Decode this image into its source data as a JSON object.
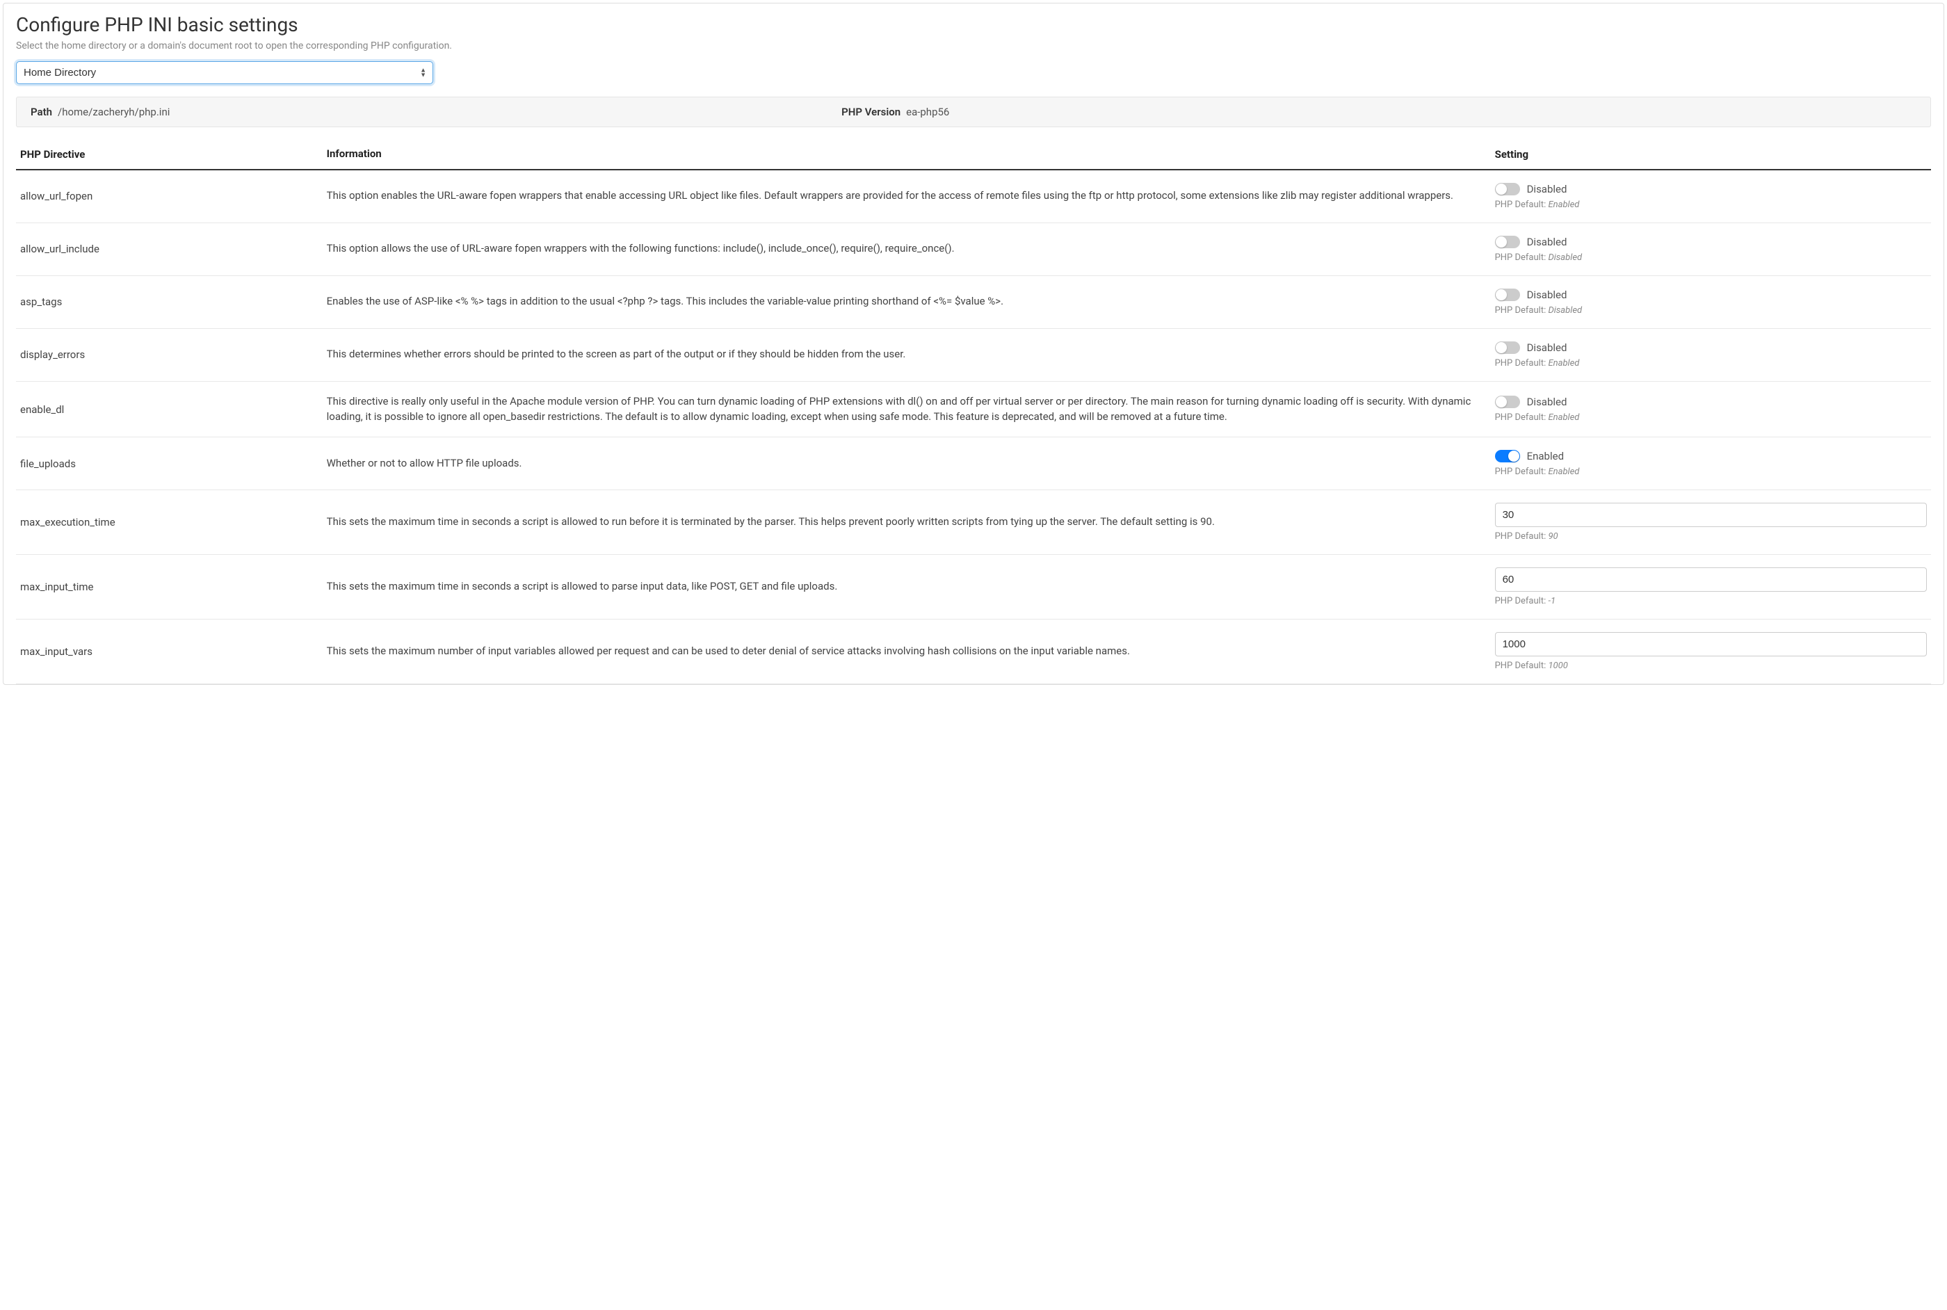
{
  "header": {
    "title": "Configure PHP INI basic settings",
    "subtitle": "Select the home directory or a domain's document root to open the corresponding PHP configuration."
  },
  "selector": {
    "selected": "Home Directory"
  },
  "infoBar": {
    "pathLabel": "Path",
    "pathValue": "/home/zacheryh/php.ini",
    "versionLabel": "PHP Version",
    "versionValue": "ea-php56"
  },
  "columns": {
    "directive": "PHP Directive",
    "info": "Information",
    "setting": "Setting"
  },
  "labels": {
    "enabled": "Enabled",
    "disabled": "Disabled",
    "phpDefault": "PHP Default:"
  },
  "directives": [
    {
      "name": "allow_url_fopen",
      "info": "This option enables the URL-aware fopen wrappers that enable accessing URL object like files. Default wrappers are provided for the access of remote files using the ftp or http protocol, some extensions like zlib may register additional wrappers.",
      "type": "toggle",
      "enabled": false,
      "default": "Enabled"
    },
    {
      "name": "allow_url_include",
      "info": "This option allows the use of URL-aware fopen wrappers with the following functions: include(), include_once(), require(), require_once().",
      "type": "toggle",
      "enabled": false,
      "default": "Disabled"
    },
    {
      "name": "asp_tags",
      "info": "Enables the use of ASP-like <% %> tags in addition to the usual <?php ?> tags. This includes the variable-value printing shorthand of <%= $value %>.",
      "type": "toggle",
      "enabled": false,
      "default": "Disabled"
    },
    {
      "name": "display_errors",
      "info": "This determines whether errors should be printed to the screen as part of the output or if they should be hidden from the user.",
      "type": "toggle",
      "enabled": false,
      "default": "Enabled"
    },
    {
      "name": "enable_dl",
      "info": "This directive is really only useful in the Apache module version of PHP. You can turn dynamic loading of PHP extensions with dl() on and off per virtual server or per directory. The main reason for turning dynamic loading off is security. With dynamic loading, it is possible to ignore all open_basedir restrictions. The default is to allow dynamic loading, except when using safe mode. This feature is deprecated, and will be removed at a future time.",
      "type": "toggle",
      "enabled": false,
      "default": "Enabled"
    },
    {
      "name": "file_uploads",
      "info": "Whether or not to allow HTTP file uploads.",
      "type": "toggle",
      "enabled": true,
      "default": "Enabled"
    },
    {
      "name": "max_execution_time",
      "info": "This sets the maximum time in seconds a script is allowed to run before it is terminated by the parser. This helps prevent poorly written scripts from tying up the server. The default setting is 90.",
      "type": "text",
      "value": "30",
      "default": "90"
    },
    {
      "name": "max_input_time",
      "info": "This sets the maximum time in seconds a script is allowed to parse input data, like POST, GET and file uploads.",
      "type": "text",
      "value": "60",
      "default": "-1"
    },
    {
      "name": "max_input_vars",
      "info": "This sets the maximum number of input variables allowed per request and can be used to deter denial of service attacks involving hash collisions on the input variable names.",
      "type": "text",
      "value": "1000",
      "default": "1000"
    }
  ]
}
